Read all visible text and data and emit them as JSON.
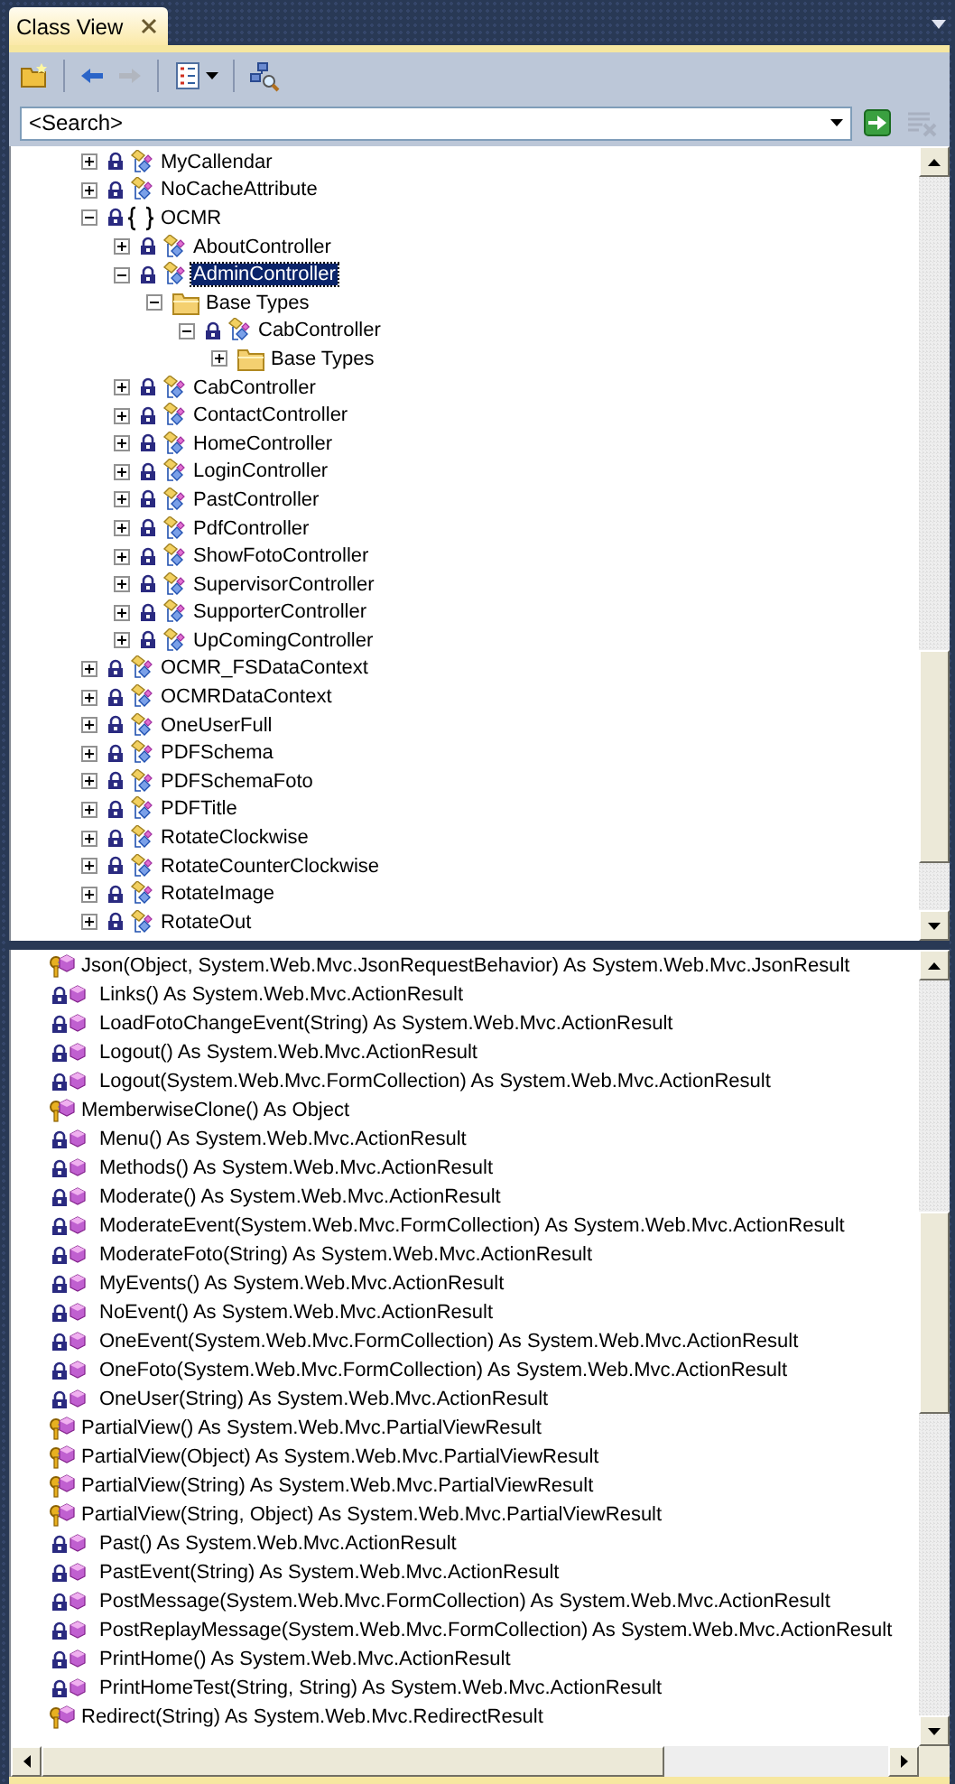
{
  "window": {
    "title": "Class View"
  },
  "toolbar": [
    {
      "kind": "new-folder",
      "disabled": false
    },
    {
      "kind": "back",
      "disabled": false
    },
    {
      "kind": "forward",
      "disabled": true
    },
    {
      "kind": "settings-menu",
      "disabled": false
    },
    {
      "kind": "find-symbol",
      "disabled": false
    }
  ],
  "search": {
    "placeholder": "<Search>"
  },
  "tree": [
    {
      "kind": "class",
      "label": "MyCallendar",
      "expanded": false,
      "selected": false
    },
    {
      "kind": "class",
      "label": "NoCacheAttribute",
      "expanded": false,
      "selected": false
    },
    {
      "kind": "namespace",
      "label": "OCMR",
      "expanded": true,
      "selected": false,
      "children": [
        {
          "kind": "class",
          "label": "AboutController",
          "expanded": false,
          "selected": false
        },
        {
          "kind": "class",
          "label": "AdminController",
          "expanded": true,
          "selected": true,
          "children": [
            {
              "kind": "folder",
              "label": "Base Types",
              "expanded": true,
              "selected": false,
              "children": [
                {
                  "kind": "class",
                  "label": "CabController",
                  "expanded": true,
                  "selected": false,
                  "children": [
                    {
                      "kind": "folder",
                      "label": "Base Types",
                      "expanded": false,
                      "selected": false
                    }
                  ]
                }
              ]
            }
          ]
        },
        {
          "kind": "class",
          "label": "CabController",
          "expanded": false,
          "selected": false
        },
        {
          "kind": "class",
          "label": "ContactController",
          "expanded": false,
          "selected": false
        },
        {
          "kind": "class",
          "label": "HomeController",
          "expanded": false,
          "selected": false
        },
        {
          "kind": "class",
          "label": "LoginController",
          "expanded": false,
          "selected": false
        },
        {
          "kind": "class",
          "label": "PastController",
          "expanded": false,
          "selected": false
        },
        {
          "kind": "class",
          "label": "PdfController",
          "expanded": false,
          "selected": false
        },
        {
          "kind": "class",
          "label": "ShowFotoController",
          "expanded": false,
          "selected": false
        },
        {
          "kind": "class",
          "label": "SupervisorController",
          "expanded": false,
          "selected": false
        },
        {
          "kind": "class",
          "label": "SupporterController",
          "expanded": false,
          "selected": false
        },
        {
          "kind": "class",
          "label": "UpComingController",
          "expanded": false,
          "selected": false
        }
      ]
    },
    {
      "kind": "class",
      "label": "OCMR_FSDataContext",
      "expanded": false,
      "selected": false
    },
    {
      "kind": "class",
      "label": "OCMRDataContext",
      "expanded": false,
      "selected": false
    },
    {
      "kind": "class",
      "label": "OneUserFull",
      "expanded": false,
      "selected": false
    },
    {
      "kind": "class",
      "label": "PDFSchema",
      "expanded": false,
      "selected": false
    },
    {
      "kind": "class",
      "label": "PDFSchemaFoto",
      "expanded": false,
      "selected": false
    },
    {
      "kind": "class",
      "label": "PDFTitle",
      "expanded": false,
      "selected": false
    },
    {
      "kind": "class",
      "label": "RotateClockwise",
      "expanded": false,
      "selected": false
    },
    {
      "kind": "class",
      "label": "RotateCounterClockwise",
      "expanded": false,
      "selected": false
    },
    {
      "kind": "class",
      "label": "RotateImage",
      "expanded": false,
      "selected": false
    },
    {
      "kind": "class",
      "label": "RotateOut",
      "expanded": false,
      "selected": false
    }
  ],
  "members": [
    {
      "kind": "protected",
      "label": "Json(Object, System.Web.Mvc.JsonRequestBehavior) As System.Web.Mvc.JsonResult"
    },
    {
      "kind": "private",
      "label": "Links() As System.Web.Mvc.ActionResult"
    },
    {
      "kind": "private",
      "label": "LoadFotoChangeEvent(String) As System.Web.Mvc.ActionResult"
    },
    {
      "kind": "private",
      "label": "Logout() As System.Web.Mvc.ActionResult"
    },
    {
      "kind": "private",
      "label": "Logout(System.Web.Mvc.FormCollection) As System.Web.Mvc.ActionResult"
    },
    {
      "kind": "protected",
      "label": "MemberwiseClone() As Object"
    },
    {
      "kind": "private",
      "label": "Menu() As System.Web.Mvc.ActionResult"
    },
    {
      "kind": "private",
      "label": "Methods() As System.Web.Mvc.ActionResult"
    },
    {
      "kind": "private",
      "label": "Moderate() As System.Web.Mvc.ActionResult"
    },
    {
      "kind": "private",
      "label": "ModerateEvent(System.Web.Mvc.FormCollection) As System.Web.Mvc.ActionResult"
    },
    {
      "kind": "private",
      "label": "ModerateFoto(String) As System.Web.Mvc.ActionResult"
    },
    {
      "kind": "private",
      "label": "MyEvents() As System.Web.Mvc.ActionResult"
    },
    {
      "kind": "private",
      "label": "NoEvent() As System.Web.Mvc.ActionResult"
    },
    {
      "kind": "private",
      "label": "OneEvent(System.Web.Mvc.FormCollection) As System.Web.Mvc.ActionResult"
    },
    {
      "kind": "private",
      "label": "OneFoto(System.Web.Mvc.FormCollection) As System.Web.Mvc.ActionResult"
    },
    {
      "kind": "private",
      "label": "OneUser(String) As System.Web.Mvc.ActionResult"
    },
    {
      "kind": "protected",
      "label": "PartialView() As System.Web.Mvc.PartialViewResult"
    },
    {
      "kind": "protected",
      "label": "PartialView(Object) As System.Web.Mvc.PartialViewResult"
    },
    {
      "kind": "protected",
      "label": "PartialView(String) As System.Web.Mvc.PartialViewResult"
    },
    {
      "kind": "protected",
      "label": "PartialView(String, Object) As System.Web.Mvc.PartialViewResult"
    },
    {
      "kind": "private",
      "label": "Past() As System.Web.Mvc.ActionResult"
    },
    {
      "kind": "private",
      "label": "PastEvent(String) As System.Web.Mvc.ActionResult"
    },
    {
      "kind": "private",
      "label": "PostMessage(System.Web.Mvc.FormCollection) As System.Web.Mvc.ActionResult"
    },
    {
      "kind": "private",
      "label": "PostReplayMessage(System.Web.Mvc.FormCollection) As System.Web.Mvc.ActionResult"
    },
    {
      "kind": "private",
      "label": "PrintHome() As System.Web.Mvc.ActionResult"
    },
    {
      "kind": "private",
      "label": "PrintHomeTest(String, String) As System.Web.Mvc.ActionResult"
    },
    {
      "kind": "protected",
      "label": "Redirect(String) As System.Web.Mvc.RedirectResult"
    }
  ]
}
